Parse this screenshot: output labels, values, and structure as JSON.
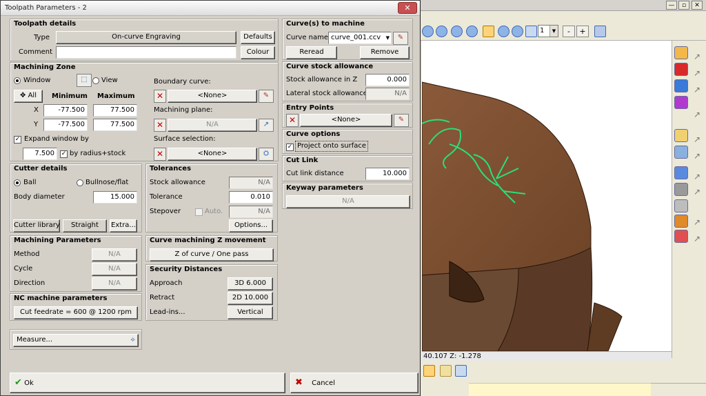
{
  "background_app": {
    "window_buttons": [
      "—",
      "▫",
      "✕"
    ],
    "toolbar": {
      "zoom_value": "1",
      "minus": "-",
      "plus": "+"
    },
    "status_coords": "40.107  Z:  -1.278"
  },
  "dialog": {
    "title": "Toolpath Parameters - 2",
    "close_glyph": "✕",
    "toolpath_details": {
      "title": "Toolpath details",
      "type_label": "Type",
      "type_value": "On-curve Engraving",
      "defaults_button": "Defaults",
      "comment_label": "Comment",
      "comment_value": "",
      "colour_button": "Colour"
    },
    "machining_zone": {
      "title": "Machining Zone",
      "window_label": "Window",
      "view_label": "View",
      "all_button": "All",
      "minimum_header": "Minimum",
      "maximum_header": "Maximum",
      "x_label": "X",
      "x_min": "-77.500",
      "x_max": "77.500",
      "y_label": "Y",
      "y_min": "-77.500",
      "y_max": "77.500",
      "expand_label": "Expand window by",
      "expand_value": "7.500",
      "by_radius_label": "by radius+stock",
      "boundary_curve_label": "Boundary curve:",
      "boundary_curve_value": "<None>",
      "machining_plane_label": "Machining plane:",
      "machining_plane_value": "N/A",
      "surface_selection_label": "Surface selection:",
      "surface_selection_value": "<None>"
    },
    "cutter_details": {
      "title": "Cutter details",
      "ball_label": "Ball",
      "bullnose_label": "Bullnose/flat",
      "body_diameter_label": "Body diameter",
      "body_diameter_value": "15.000",
      "cutter_library_button": "Cutter library",
      "straight_label": "Straight",
      "extra_button": "Extra..."
    },
    "tolerances": {
      "title": "Tolerances",
      "stock_allowance_label": "Stock allowance",
      "stock_allowance_value": "N/A",
      "tolerance_label": "Tolerance",
      "tolerance_value": "0.010",
      "stepover_label": "Stepover",
      "auto_label": "Auto.",
      "stepover_value": "N/A",
      "options_button": "Options..."
    },
    "machining_parameters": {
      "title": "Machining Parameters",
      "method_label": "Method",
      "method_value": "N/A",
      "cycle_label": "Cycle",
      "cycle_value": "N/A",
      "direction_label": "Direction",
      "direction_value": "N/A"
    },
    "curve_z_movement": {
      "title": "Curve machining Z movement",
      "value": "Z of curve / One pass"
    },
    "security_distances": {
      "title": "Security Distances",
      "approach_label": "Approach",
      "approach_value": "3D 6.000",
      "retract_label": "Retract",
      "retract_value": "2D 10.000",
      "leadins_label": "Lead-ins...",
      "leadins_value": "Vertical"
    },
    "nc_machine": {
      "title": "NC machine parameters",
      "feedrate_button": "Cut feedrate = 600 @ 1200 rpm"
    },
    "measure_button": "Measure...",
    "curves_to_machine": {
      "title": "Curve(s) to machine",
      "curve_name_label": "Curve name",
      "curve_name_value": "curve_001.ccv",
      "reread_button": "Reread",
      "remove_button": "Remove"
    },
    "curve_stock_allowance": {
      "title": "Curve stock allowance",
      "stock_in_z_label": "Stock allowance in Z",
      "stock_in_z_value": "0.000",
      "lateral_label": "Lateral stock allowance",
      "lateral_value": "N/A"
    },
    "entry_points": {
      "title": "Entry Points",
      "value": "<None>"
    },
    "curve_options": {
      "title": "Curve options",
      "project_label": "Project onto surface"
    },
    "cut_link": {
      "title": "Cut Link",
      "distance_label": "Cut link distance",
      "distance_value": "10.000"
    },
    "keyway": {
      "title": "Keyway parameters",
      "value": "N/A"
    },
    "ok_button": "Ok",
    "cancel_button": "Cancel"
  }
}
